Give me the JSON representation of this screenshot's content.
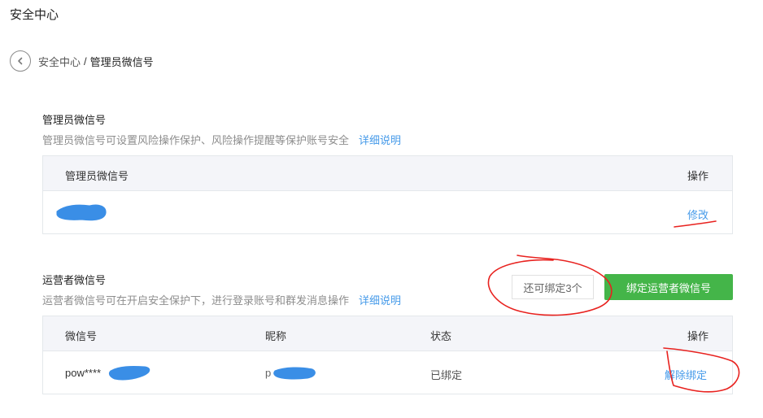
{
  "page": {
    "title": "安全中心"
  },
  "breadcrumb": {
    "parent": "安全中心",
    "separator": "/",
    "current": "管理员微信号"
  },
  "admin_section": {
    "title": "管理员微信号",
    "description": "管理员微信号可设置风险操作保护、风险操作提醒等保护账号安全",
    "detail_link": "详细说明",
    "table": {
      "headers": [
        "管理员微信号",
        "操作"
      ],
      "rows": [
        {
          "wechat_id": "",
          "action": "修改"
        }
      ]
    }
  },
  "operator_section": {
    "title": "运营者微信号",
    "description": "运营者微信号可在开启安全保护下，进行登录账号和群发消息操作",
    "detail_link": "详细说明",
    "quota_text": "还可绑定3个",
    "bind_button": "绑定运营者微信号",
    "table": {
      "headers": [
        "微信号",
        "昵称",
        "状态",
        "操作"
      ],
      "rows": [
        {
          "wechat_id": "pow****",
          "nickname": "p",
          "status": "已绑定",
          "action": "解除绑定"
        }
      ]
    }
  },
  "colors": {
    "link": "#459ae9",
    "primary_button": "#44b549",
    "annotation": "#e8221f",
    "redaction": "#3a8ee6"
  },
  "icons": {
    "back": "chevron-left-circle-icon"
  }
}
